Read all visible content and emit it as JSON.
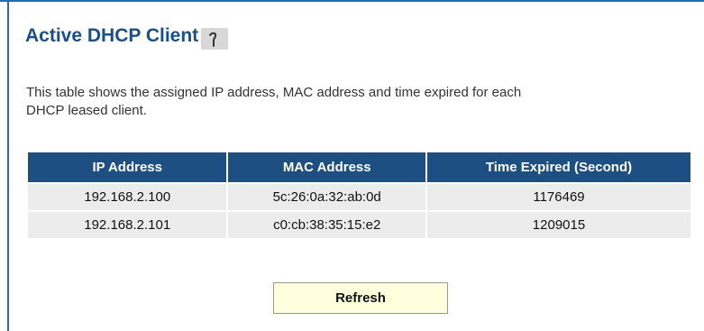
{
  "page": {
    "title": "Active DHCP Client",
    "help_icon": "help-icon",
    "description_line1": "This table shows the assigned IP address, MAC address and time expired for each",
    "description_line2": "DHCP leased client."
  },
  "table": {
    "headers": [
      "IP Address",
      "MAC Address",
      "Time Expired (Second)"
    ],
    "rows": [
      [
        "192.168.2.100",
        "5c:26:0a:32:ab:0d",
        "1176469"
      ],
      [
        "192.168.2.101",
        "c0:cb:38:35:15:e2",
        "1209015"
      ]
    ]
  },
  "actions": {
    "refresh_label": "Refresh"
  },
  "colors": {
    "accent": "#1c6fb0",
    "title": "#1a4f8a",
    "header_bg": "#1e4f82",
    "row_bg": "#ececec",
    "button_bg": "#ffffdd"
  }
}
